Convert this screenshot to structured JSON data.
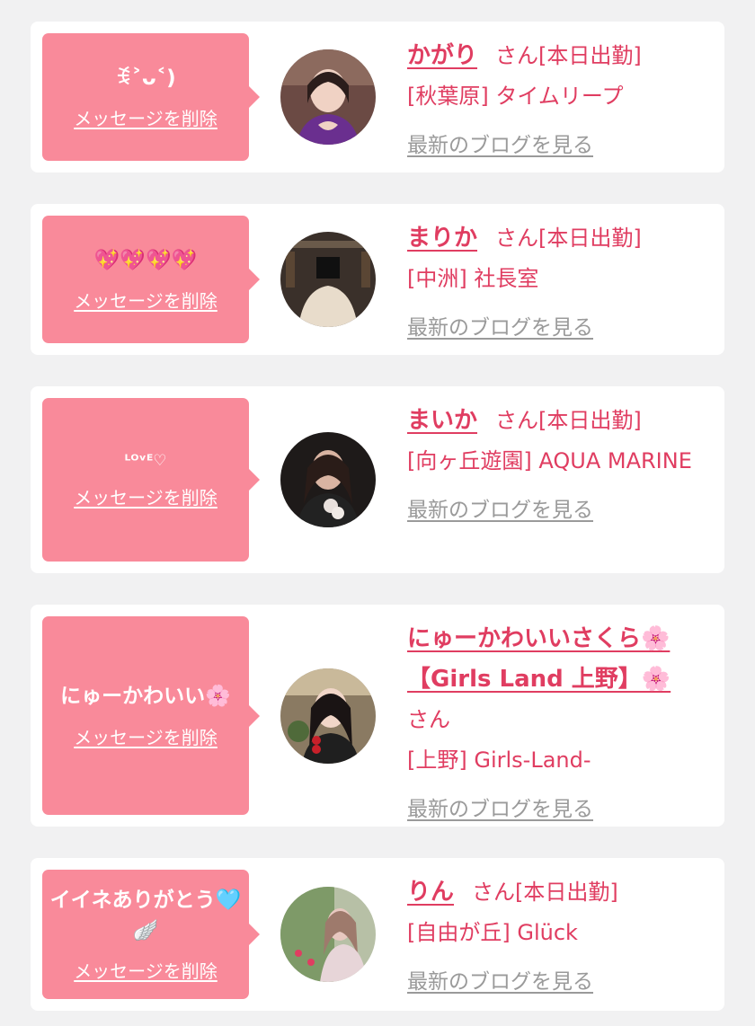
{
  "common": {
    "delete_label": "メッセージを削除",
    "blog_label": "最新のブログを見る"
  },
  "cards": [
    {
      "message": "ꉂ˃ᴗ˂)",
      "name": "かがり",
      "san": "さん",
      "status": "[本日出勤]",
      "area": "[秋葉原]",
      "shop": "タイムリープ",
      "avatar_icon": "profile-photo"
    },
    {
      "message": "💖💖💖💖",
      "name": "まりか",
      "san": "さん",
      "status": "[本日出勤]",
      "area": "[中洲]",
      "shop": "社長室",
      "avatar_icon": "profile-photo"
    },
    {
      "message": "ᴸᴼᵛᴱ♡",
      "name": "まいか",
      "san": "さん",
      "status": "[本日出勤]",
      "area": "[向ヶ丘遊園]",
      "shop": "AQUA MARINE",
      "avatar_icon": "profile-photo"
    },
    {
      "message": "にゅーかわいい🌸",
      "name": "にゅーかわいいさくら🌸【Girls Land 上野】🌸",
      "san": "さん",
      "status": "",
      "area": "[上野]",
      "shop": "Girls-Land-",
      "avatar_icon": "profile-photo"
    },
    {
      "message": "イイネありがとう🩵🪽",
      "name": "りん",
      "san": "さん",
      "status": "[本日出勤]",
      "area": "[自由が丘]",
      "shop": "Glück",
      "avatar_icon": "profile-photo"
    }
  ]
}
